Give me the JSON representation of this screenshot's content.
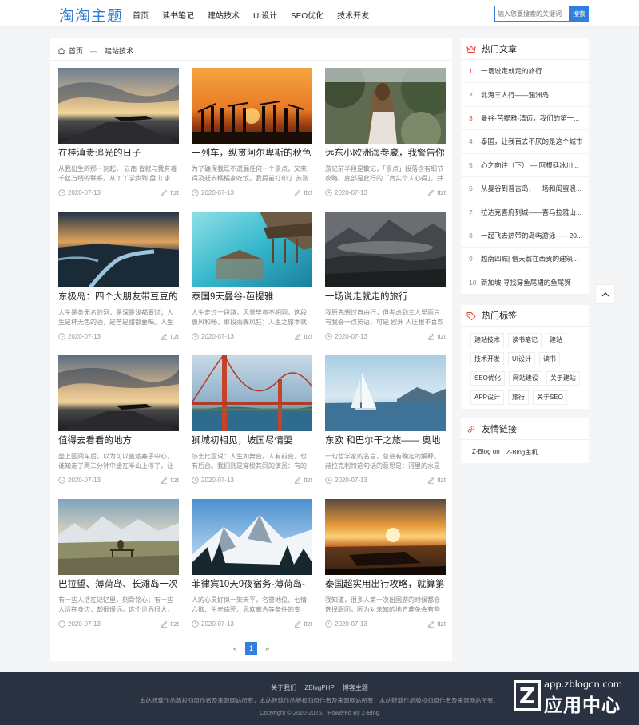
{
  "header": {
    "logo": "淘淘主题",
    "nav": [
      "首页",
      "读书笔记",
      "建站技术",
      "UI设计",
      "SEO优化",
      "技术开发"
    ],
    "search_placeholder": "输入您要搜索的关键词",
    "search_button": "搜索"
  },
  "breadcrumb": {
    "home": "首页",
    "separator": "—",
    "current": "建站技术"
  },
  "posts": [
    {
      "title": "在桂滇贵追光的日子",
      "desc": "从我出生的那一刻起， 云南 省就与我有着千丝万缕的联系。从丫丫学步到 盘山 求",
      "date": "2020-07-13",
      "author": "ttzt"
    },
    {
      "title": "一列车，纵贯阿尔卑斯的秋色",
      "desc": "为了确保我既不遗漏任何一个景点，又来得及赶去橘橘家吃饭。我提前打印了 苏黎",
      "date": "2020-07-13",
      "author": "ttzt"
    },
    {
      "title": "远东小欧洲海参崴，我警告你",
      "desc": "游记前半段是散记，「景点」段落含有细节攻略，底部是此行的「真实个人心得」，并",
      "date": "2020-07-13",
      "author": "ttzt"
    },
    {
      "title": "东极岛：四个大朋友带豆豆的",
      "desc": "人生是条无名的河，是深是浅都要过；人生是杯无色的酒，是苦是甜都要喝。人生是首",
      "date": "2020-07-13",
      "author": "ttzt"
    },
    {
      "title": "泰国9天曼谷-芭提雅",
      "desc": "人生走过一段路，风景毕竟不相同，这段惠风和畅，那段雨骤风狂；人生之旅本就是风",
      "date": "2020-07-13",
      "author": "ttzt"
    },
    {
      "title": "一场说走就走的旅行",
      "desc": "我原先想过自由行，但考虑到三人里面只有我会一点英语，可是 欧洲 人压根不喜欢说",
      "date": "2020-07-13",
      "author": "ttzt"
    },
    {
      "title": "值得去看看的地方",
      "desc": "坐上区间车后，以为可以直达寨子中心，谁知走了两三分钟中途在半山上停了，让下",
      "date": "2020-07-13",
      "author": "ttzt"
    },
    {
      "title": "狮城初相见，坡国尽情耍",
      "desc": "莎士比亚说：人生如舞台。人有前台，也有后台。我们则是穿梭其间的演员：有的人偶",
      "date": "2020-07-13",
      "author": "ttzt"
    },
    {
      "title": "东欧 和巴尔干之旅—— 奥地",
      "desc": "一句哲学家的名言，总会有确定的解释。赫拉克利特这句话的意思是：河里的水是不断",
      "date": "2020-07-13",
      "author": "ttzt"
    },
    {
      "title": "巴拉望、薄荷岛、长滩岛一次",
      "desc": "有一些人活在记忆里，刻骨铭心；有一些人活在身边，却很遥远。这个世界很大，即使",
      "date": "2020-07-13",
      "author": "ttzt"
    },
    {
      "title": "菲律宾10天9夜宿务-薄荷岛-",
      "desc": "人的心灵好似一架天平，名誉地位、七情六欲、生老病死、恩欢离合等条件的变化，都",
      "date": "2020-07-13",
      "author": "ttzt"
    },
    {
      "title": "泰国超实用出行攻略，就算第",
      "desc": "我知道，很多人第一次出国游的时候都会选择跟团，因为对未知的地方难免会有些抱",
      "date": "2020-07-13",
      "author": "ttzt"
    }
  ],
  "pager": {
    "prev": "«",
    "current": "1",
    "next": "»"
  },
  "hot": {
    "title": "热门文章",
    "items": [
      {
        "n": "1",
        "text": "一场说走就走的旅行"
      },
      {
        "n": "2",
        "text": "北海三人行——涠洲岛"
      },
      {
        "n": "3",
        "text": "曼谷-芭提雅-清迈，我们的第一..."
      },
      {
        "n": "4",
        "text": "泰国，让我百去不厌的是这个城市"
      },
      {
        "n": "5",
        "text": "心之向往（下） — 阿根廷冰川..."
      },
      {
        "n": "6",
        "text": "从曼谷到普吉岛，一场和闺蜜浪..."
      },
      {
        "n": "7",
        "text": "拉达克喜府列城——喜马拉雅山..."
      },
      {
        "n": "8",
        "text": "一起飞去热带的岛屿游泳——20..."
      },
      {
        "n": "9",
        "text": "越南四城| 信天翁在西贡的建筑..."
      },
      {
        "n": "10",
        "text": "新加坡|寻找穿鱼尾裙的鱼尾狮"
      }
    ]
  },
  "tags": {
    "title": "热门标签",
    "items": [
      "建站技术",
      "读书笔记",
      "建站",
      "技术开发",
      "UI设计",
      "读书",
      "SEO优化",
      "网站建设",
      "关于建站",
      "APP设计",
      "旅行",
      "关于SEO"
    ]
  },
  "links": {
    "title": "友情链接",
    "items": [
      "Z-Blog on",
      "Z-Blog主机"
    ]
  },
  "footer": {
    "links": [
      "关于我们",
      "ZBlogPHP",
      "博客主题"
    ],
    "notice": "本站转载作品版权归原作者及来源网站所有，本站转载作品版权归原作者及来源网站所有，本站转载作品版权归原作者及来源网站所有。",
    "copyright": "Copyright © 2020-2025。Powered By Z-Blog"
  },
  "watermark": {
    "letter": "Z",
    "url": "app.zblogcn.com",
    "text": "应用中心"
  },
  "colors": {
    "accent": "#2f7ee0",
    "hot_red": "#e5412d",
    "footer_bg": "#2a3140"
  }
}
